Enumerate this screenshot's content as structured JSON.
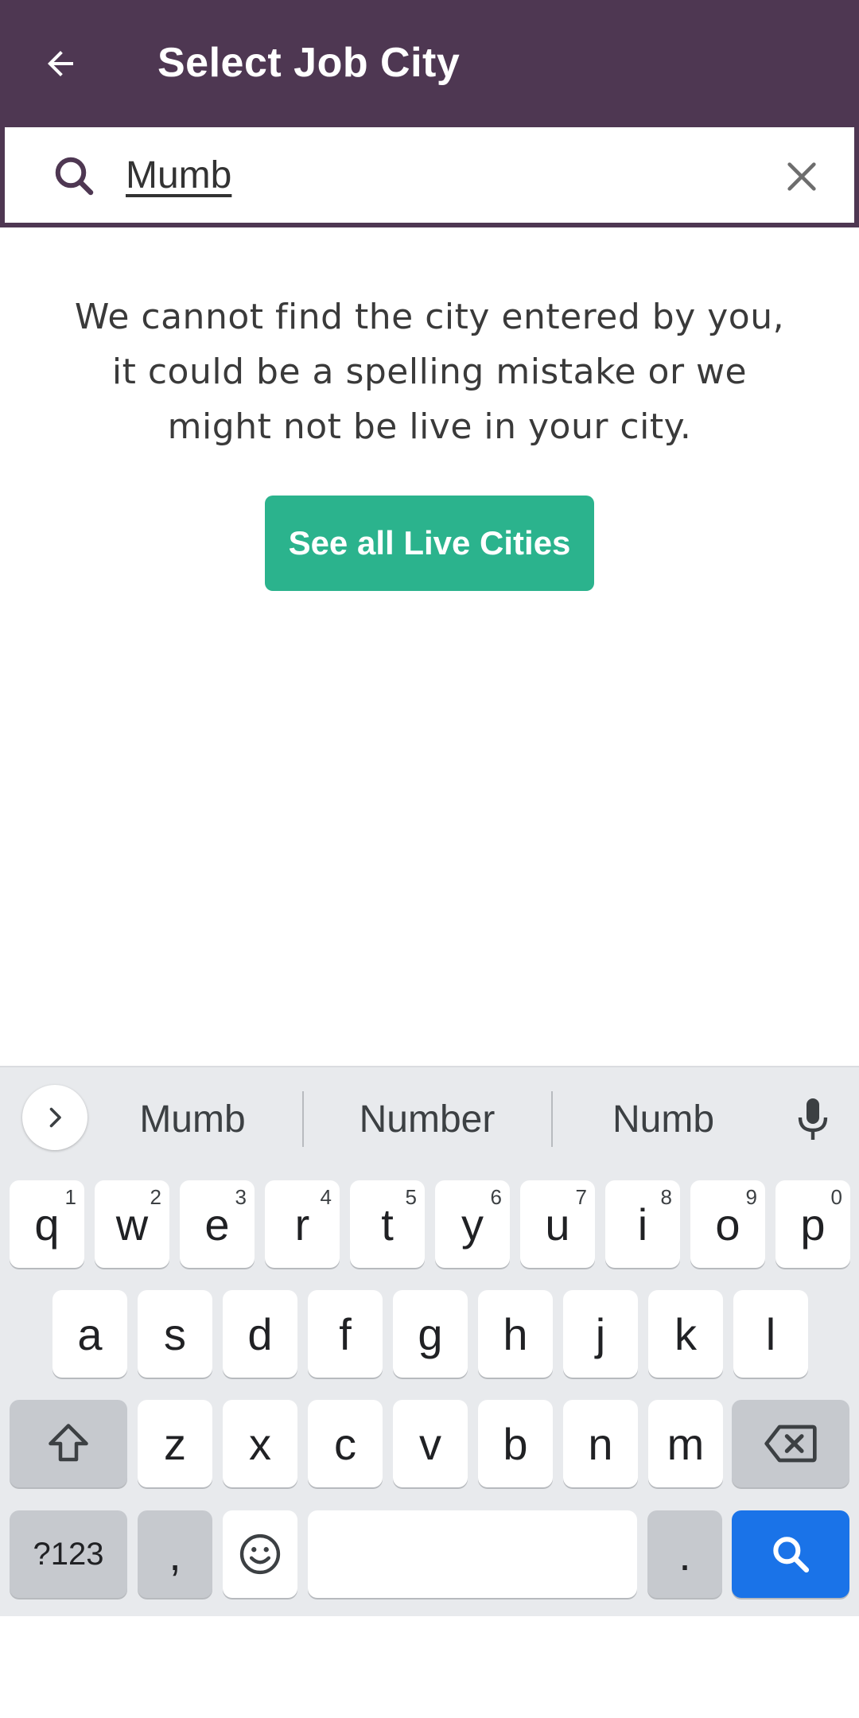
{
  "appbar": {
    "title": "Select Job City",
    "back_icon": "arrow-left-icon"
  },
  "search": {
    "value": "Mumb",
    "search_icon": "search-icon",
    "clear_icon": "close-icon"
  },
  "message": {
    "text": "We cannot find the city entered by you, it could be a spelling mistake or we might not be live in your city."
  },
  "cta": {
    "label": "See all Live Cities"
  },
  "colors": {
    "appbar": "#4e3752",
    "cta": "#2bb38d",
    "keyboard": "#e8eaed",
    "enter_key": "#1a73e8"
  },
  "keyboard": {
    "suggestions": [
      "Mumb",
      "Number",
      "Numb"
    ],
    "row1": [
      {
        "k": "q",
        "h": "1"
      },
      {
        "k": "w",
        "h": "2"
      },
      {
        "k": "e",
        "h": "3"
      },
      {
        "k": "r",
        "h": "4"
      },
      {
        "k": "t",
        "h": "5"
      },
      {
        "k": "y",
        "h": "6"
      },
      {
        "k": "u",
        "h": "7"
      },
      {
        "k": "i",
        "h": "8"
      },
      {
        "k": "o",
        "h": "9"
      },
      {
        "k": "p",
        "h": "0"
      }
    ],
    "row2": [
      "a",
      "s",
      "d",
      "f",
      "g",
      "h",
      "j",
      "k",
      "l"
    ],
    "row3": [
      "z",
      "x",
      "c",
      "v",
      "b",
      "n",
      "m"
    ],
    "symbols_label": "?123",
    "comma": ",",
    "period": "."
  }
}
